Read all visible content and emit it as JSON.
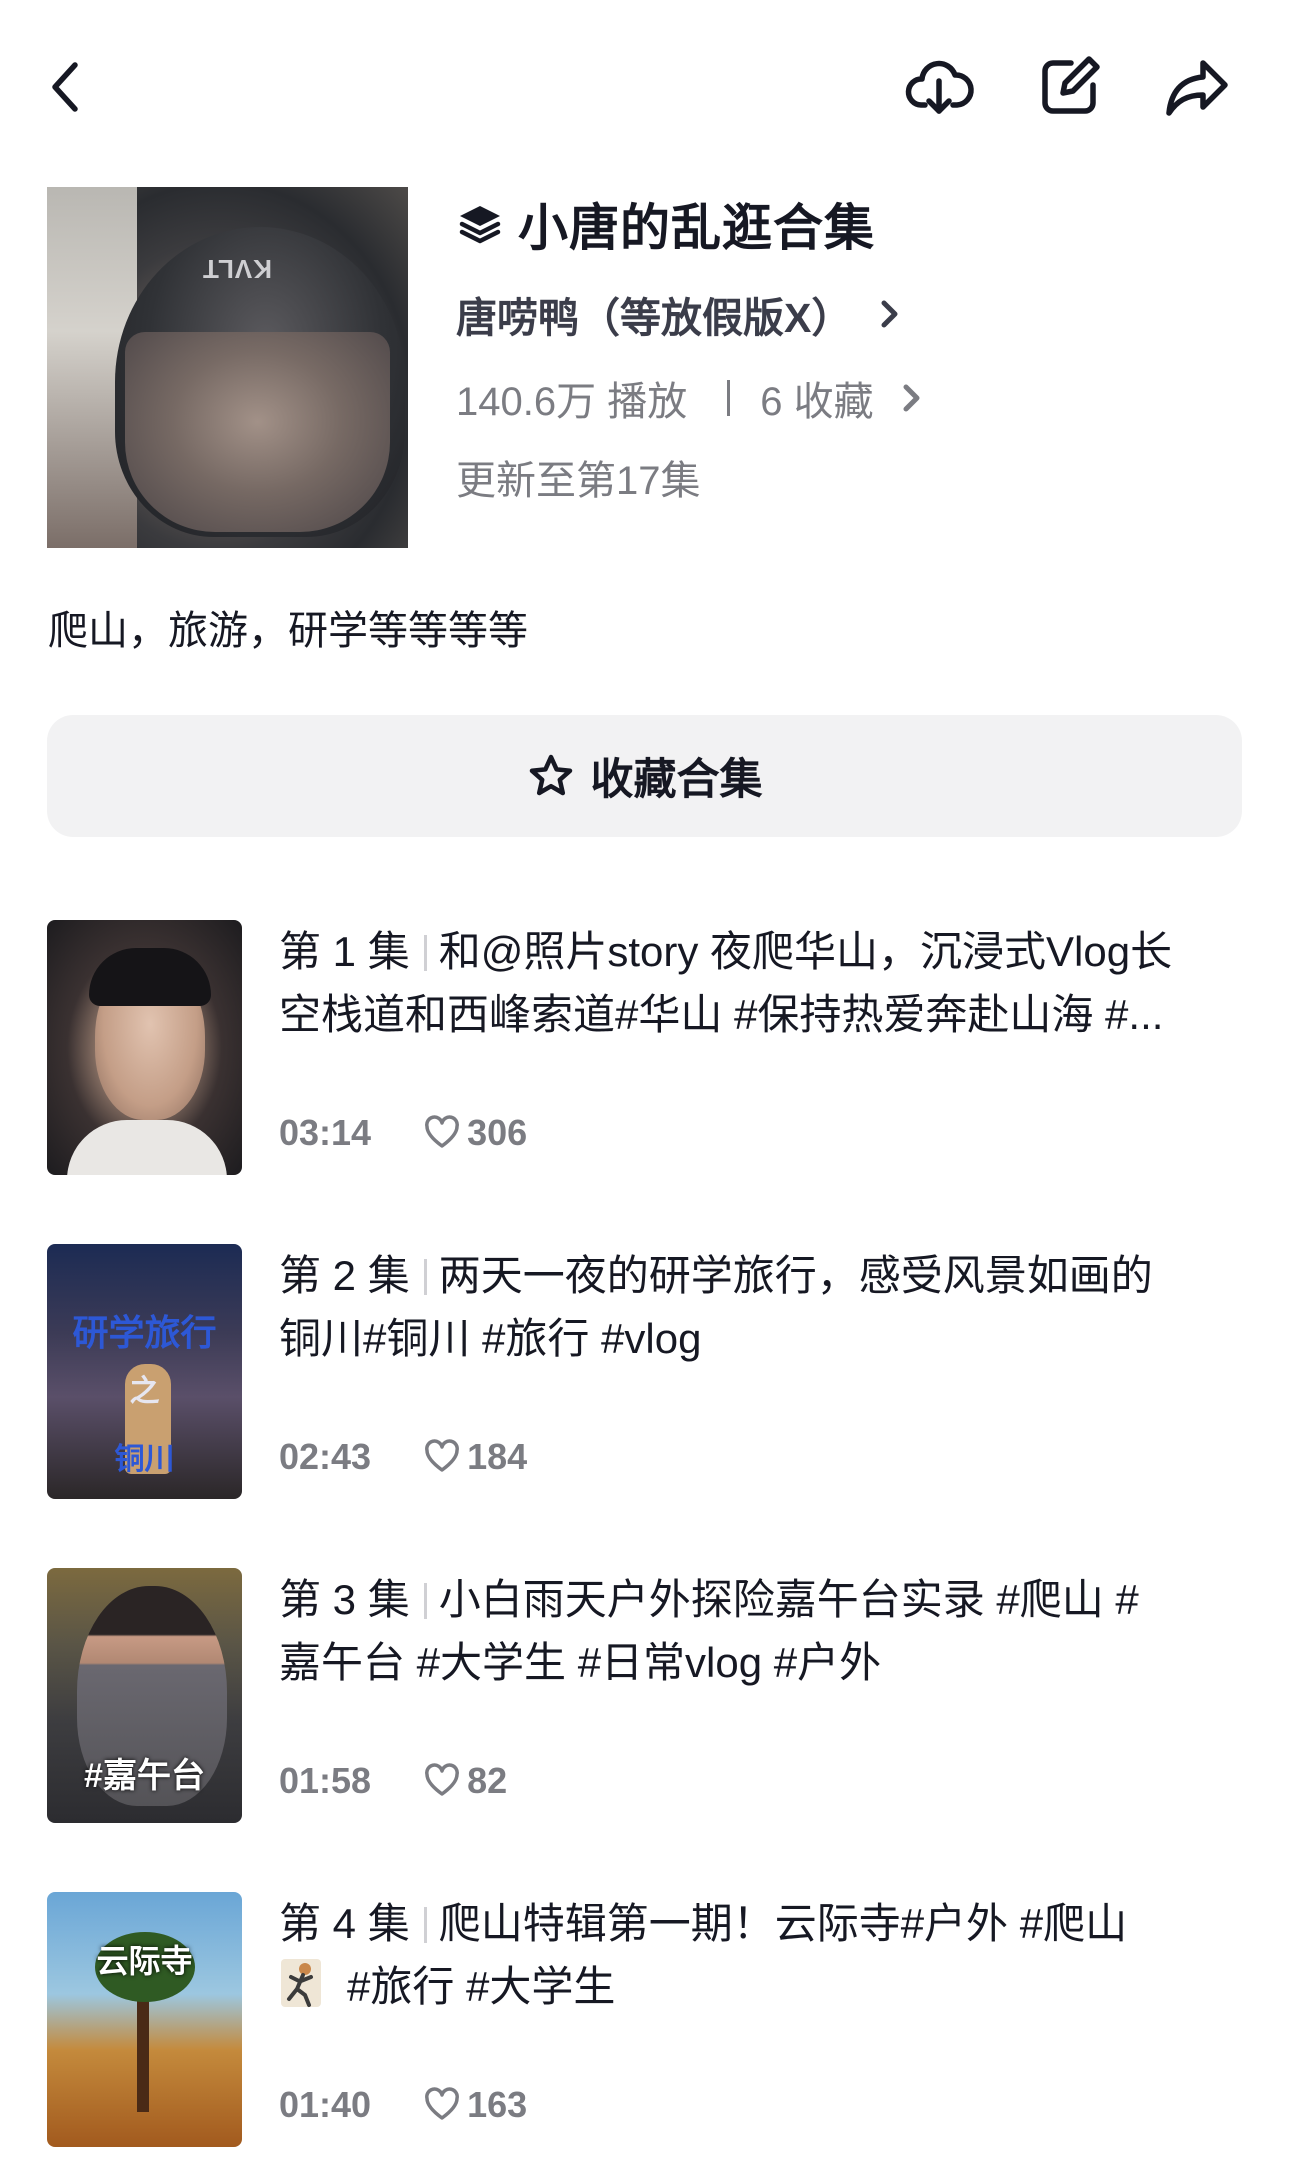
{
  "topbar": {
    "icons": [
      "back-icon",
      "download-icon",
      "edit-icon",
      "share-icon"
    ]
  },
  "collection": {
    "title": "小唐的乱逛合集",
    "author": "唐唠鸭（等放假版X）",
    "plays": "140.6万 播放",
    "favorites": "6  收藏",
    "update": "更新至第17集",
    "description": "爬山，旅游，研学等等等等",
    "cover_brand": "KVLT"
  },
  "collect_button": {
    "label": "收藏合集"
  },
  "episodes": [
    {
      "number": "第 1 集",
      "line1": "和@照片story 夜爬华山，沉浸式Vlog长",
      "line2": "空栈道和西峰索道#华山 #保持热爱奔赴山海 #...",
      "duration": "03:14",
      "likes": "306"
    },
    {
      "number": "第 2 集",
      "line1": "两天一夜的研学旅行，感受风景如画的",
      "line2": "铜川#铜川 #旅行 #vlog",
      "duration": "02:43",
      "likes": "184",
      "thumb_text_top": "研学旅行",
      "thumb_text_mid": "之",
      "thumb_text_bottom": "铜川"
    },
    {
      "number": "第 3 集",
      "line1": "小白雨天户外探险嘉午台实录 #爬山 #",
      "line2": "嘉午台 #大学生 #日常vlog #户外",
      "duration": "01:58",
      "likes": "82",
      "thumb_tag": "#嘉午台"
    },
    {
      "number": "第 4 集",
      "line1": "爬山特辑第一期！云际寺#户外 #爬山",
      "line2": "#旅行 #大学生",
      "duration": "01:40",
      "likes": "163",
      "thumb_tag": "云际寺"
    }
  ],
  "colors": {
    "text_primary": "#161823",
    "text_secondary": "#7b7c82",
    "button_bg": "#f2f2f3"
  }
}
